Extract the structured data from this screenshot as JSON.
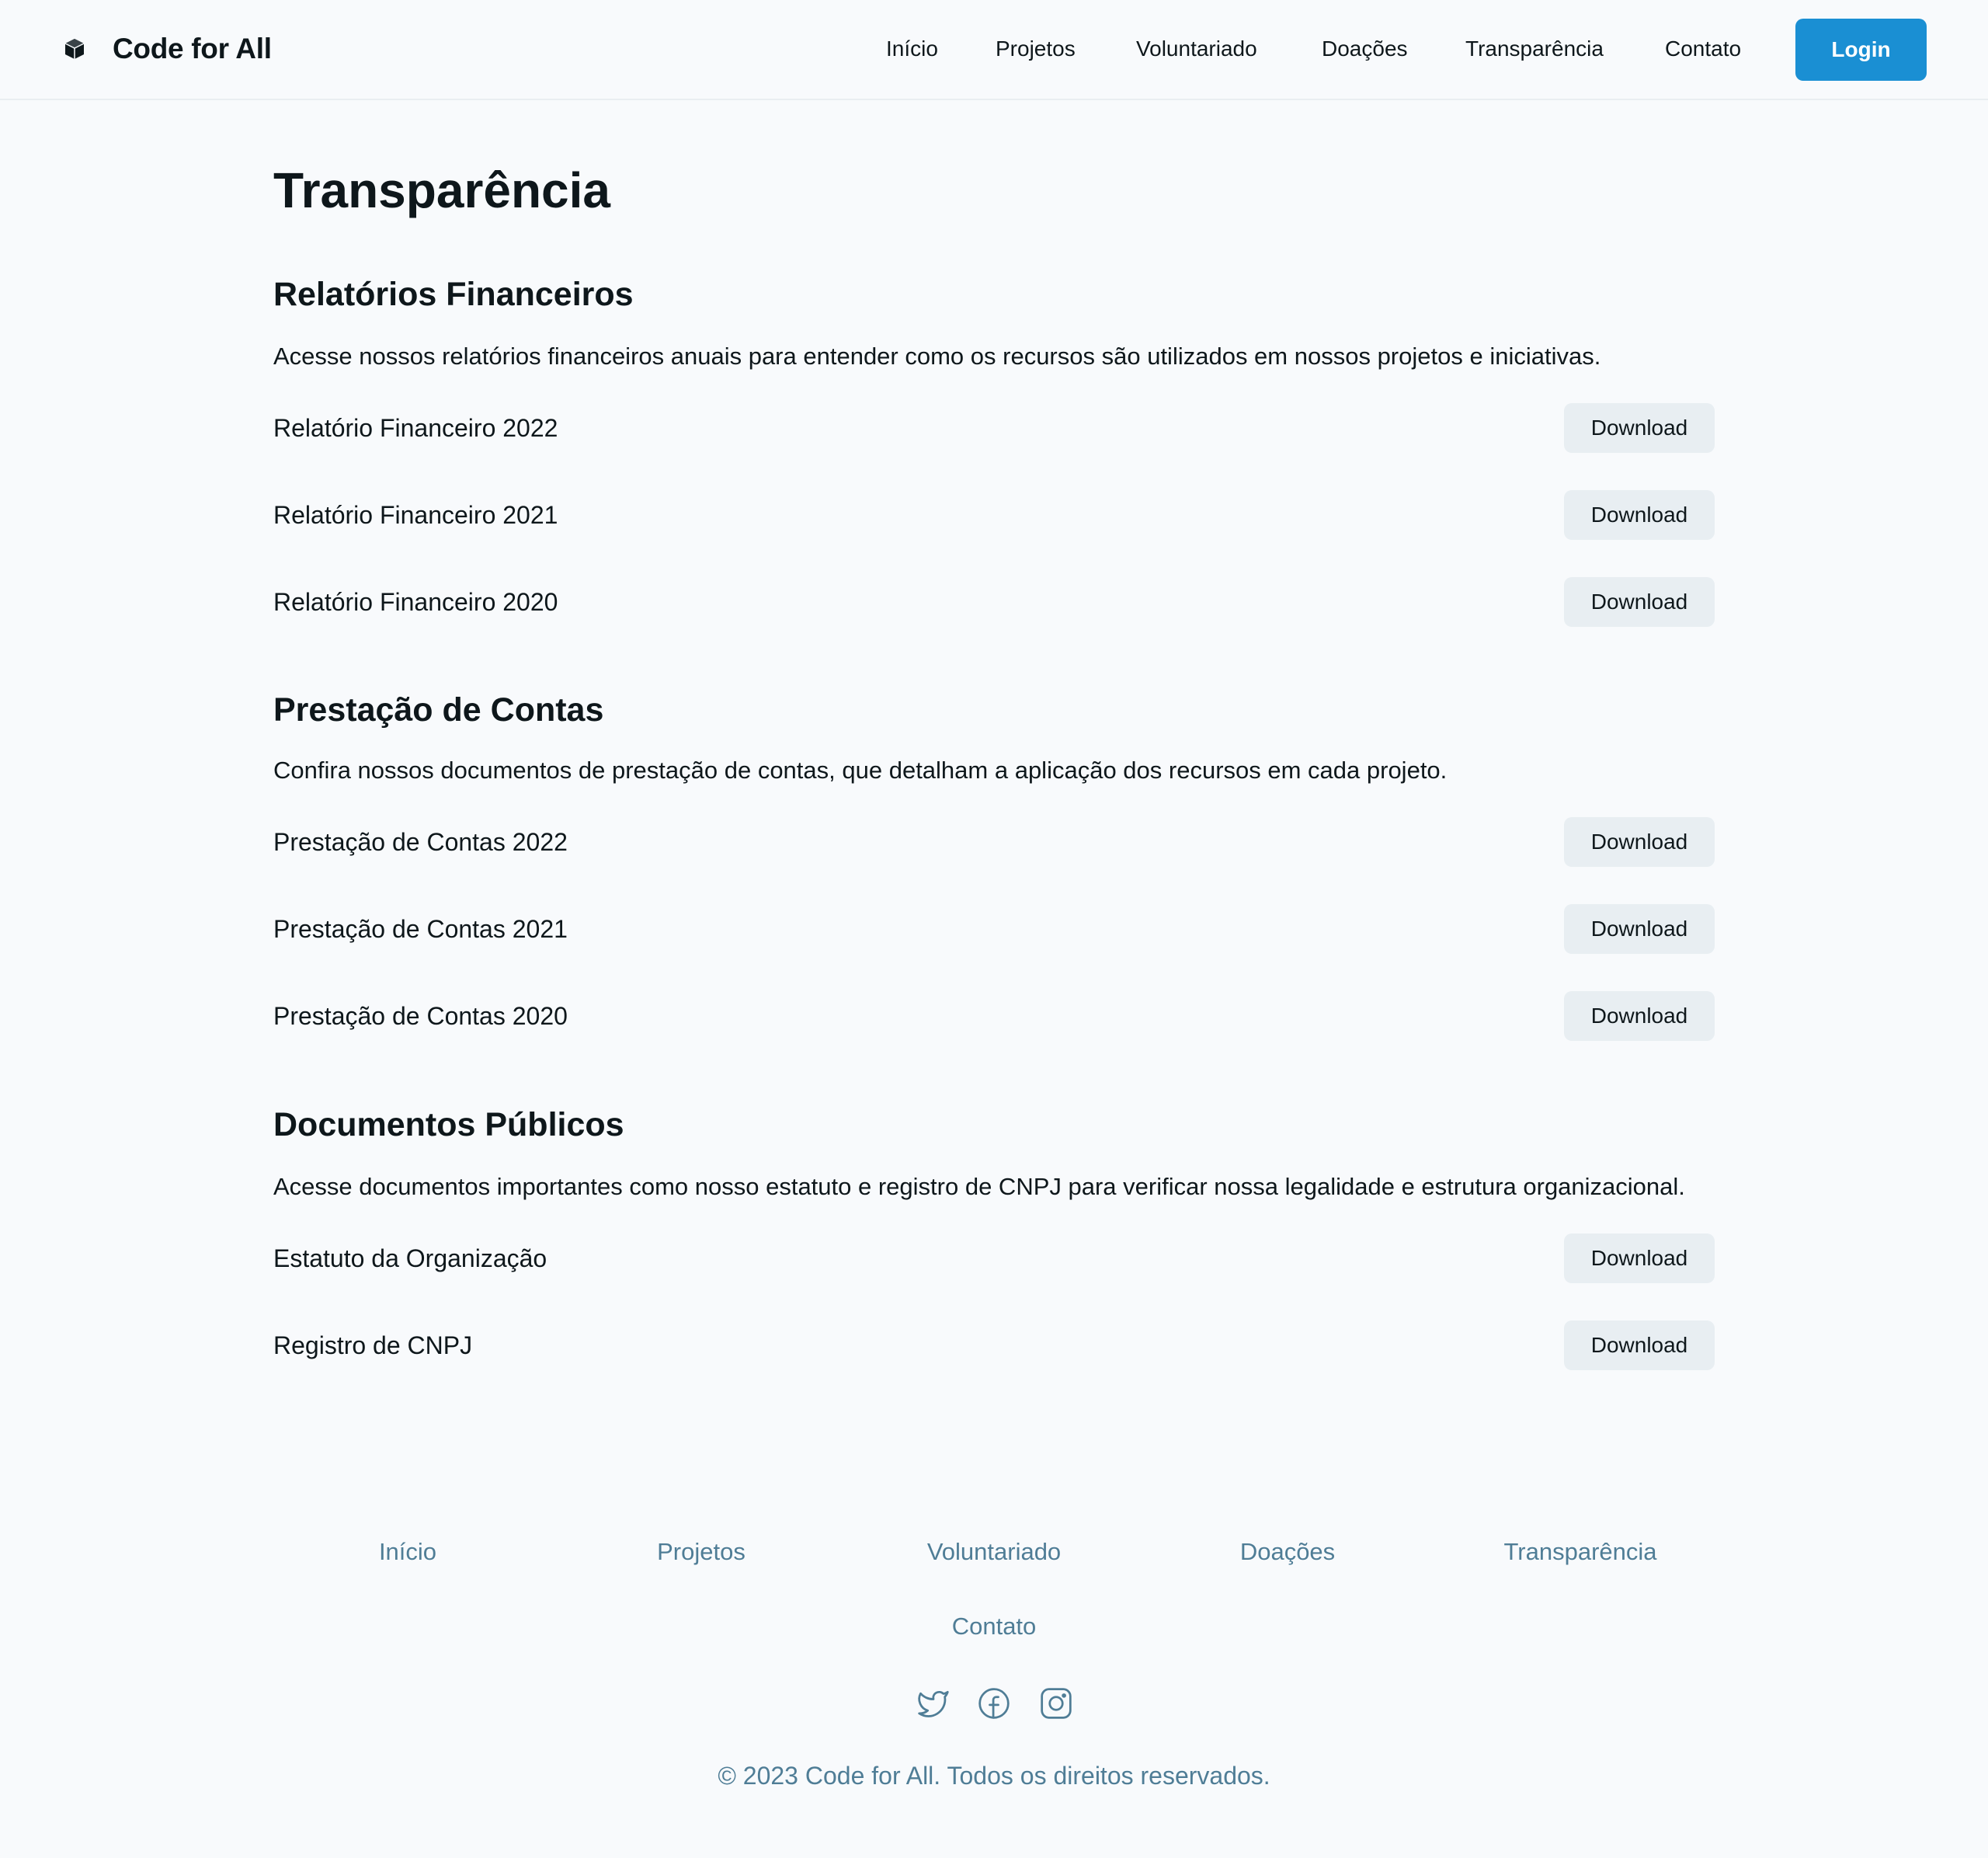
{
  "header": {
    "brand": "Code for All",
    "nav": [
      "Início",
      "Projetos",
      "Voluntariado",
      "Doações",
      "Transparência",
      "Contato"
    ],
    "login_label": "Login"
  },
  "main": {
    "title": "Transparência",
    "sections": [
      {
        "title": "Relatórios Financeiros",
        "description": "Acesse nossos relatórios financeiros anuais para entender como os recursos são utilizados em nossos projetos e iniciativas.",
        "documents": [
          {
            "label": "Relatório Financeiro 2022",
            "action": "Download"
          },
          {
            "label": "Relatório Financeiro 2021",
            "action": "Download"
          },
          {
            "label": "Relatório Financeiro 2020",
            "action": "Download"
          }
        ]
      },
      {
        "title": "Prestação de Contas",
        "description": "Confira nossos documentos de prestação de contas, que detalham a aplicação dos recursos em cada projeto.",
        "documents": [
          {
            "label": "Prestação de Contas 2022",
            "action": "Download"
          },
          {
            "label": "Prestação de Contas 2021",
            "action": "Download"
          },
          {
            "label": "Prestação de Contas 2020",
            "action": "Download"
          }
        ]
      },
      {
        "title": "Documentos Públicos",
        "description": "Acesse documentos importantes como nosso estatuto e registro de CNPJ para verificar nossa legalidade e estrutura organizacional.",
        "documents": [
          {
            "label": "Estatuto da Organização",
            "action": "Download"
          },
          {
            "label": "Registro de CNPJ",
            "action": "Download"
          }
        ]
      }
    ]
  },
  "footer": {
    "links": [
      "Início",
      "Projetos",
      "Voluntariado",
      "Doações",
      "Transparência",
      "Contato"
    ],
    "social_icons": [
      "twitter-icon",
      "facebook-icon",
      "instagram-icon"
    ],
    "copyright": "© 2023 Code for All. Todos os direitos reservados."
  },
  "colors": {
    "background": "#f8fafc",
    "primary": "#1a8fd3",
    "text": "#0e171b",
    "muted": "#4f7d96",
    "button_secondary": "#e8eef2"
  }
}
